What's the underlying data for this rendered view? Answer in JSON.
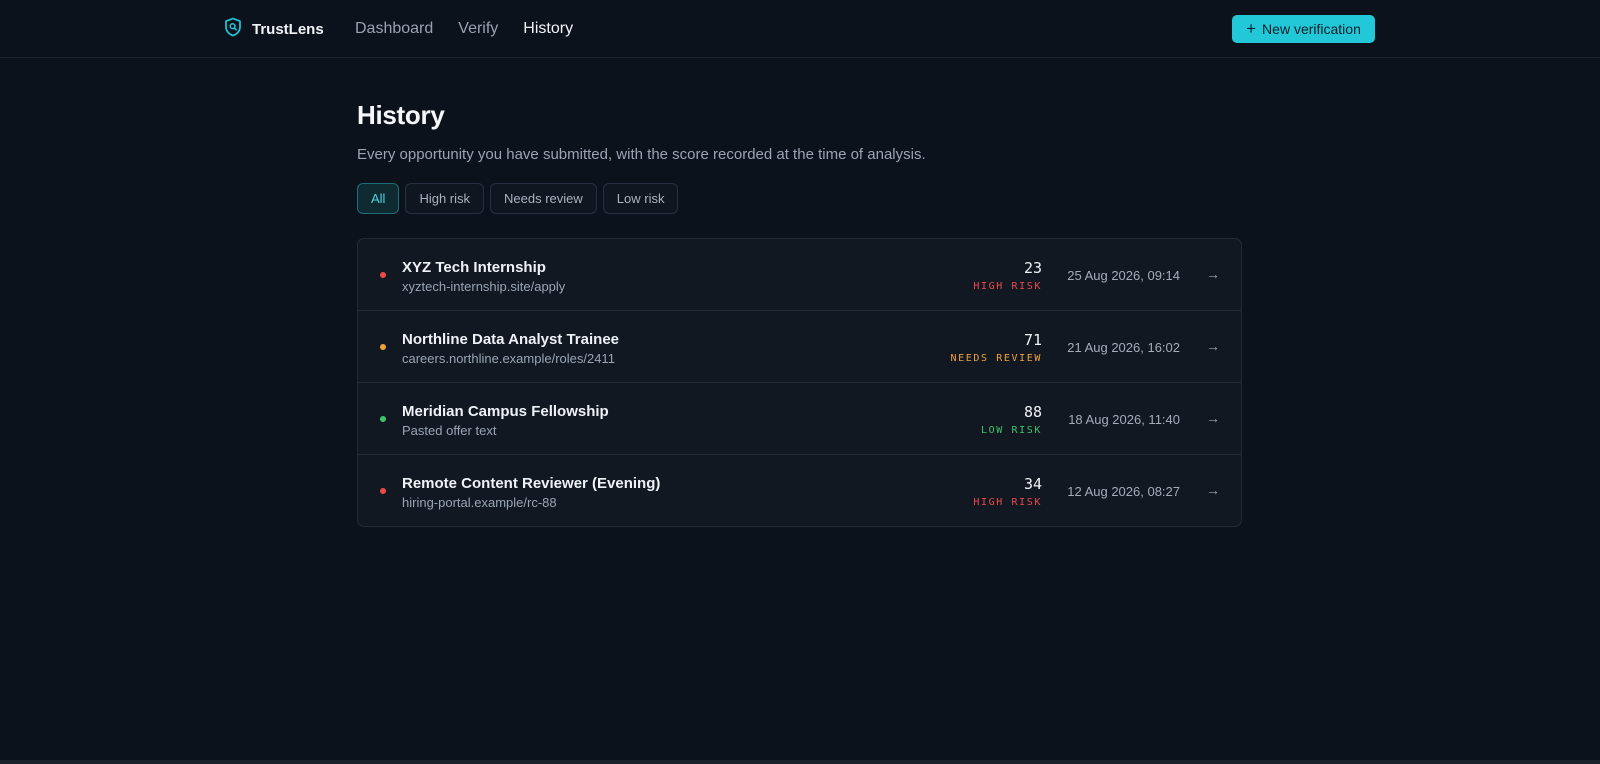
{
  "header": {
    "brand": "TrustLens",
    "nav": [
      {
        "label": "Dashboard",
        "active": false
      },
      {
        "label": "Verify",
        "active": false
      },
      {
        "label": "History",
        "active": true
      }
    ],
    "new_button": "New verification"
  },
  "page": {
    "title": "History",
    "subtitle": "Every opportunity you have submitted, with the score recorded at the time of analysis."
  },
  "filters": [
    {
      "label": "All",
      "active": true
    },
    {
      "label": "High risk",
      "active": false
    },
    {
      "label": "Needs review",
      "active": false
    },
    {
      "label": "Low risk",
      "active": false
    }
  ],
  "rows": [
    {
      "title": "XYZ Tech Internship",
      "source": "xyztech-internship.site/apply",
      "score": "23",
      "risk": "HIGH RISK",
      "date": "25 Aug 2026, 09:14"
    },
    {
      "title": "Northline Data Analyst Trainee",
      "source": "careers.northline.example/roles/2411",
      "score": "71",
      "risk": "NEEDS REVIEW",
      "date": "21 Aug 2026, 16:02"
    },
    {
      "title": "Meridian Campus Fellowship",
      "source": "Pasted offer text",
      "score": "88",
      "risk": "LOW RISK",
      "date": "18 Aug 2026, 11:40"
    },
    {
      "title": "Remote Content Reviewer (Evening)",
      "source": "hiring-portal.example/rc-88",
      "score": "34",
      "risk": "HIGH RISK",
      "date": "12 Aug 2026, 08:27"
    }
  ],
  "colors": {
    "accent": "#22c8d8",
    "high_risk": "#f0484a",
    "needs_review": "#f0a23a",
    "low_risk": "#3ec46d"
  },
  "icons": {
    "brand": "shield-search-icon",
    "new_button": "plus-icon",
    "row_action": "arrow-right-icon"
  }
}
